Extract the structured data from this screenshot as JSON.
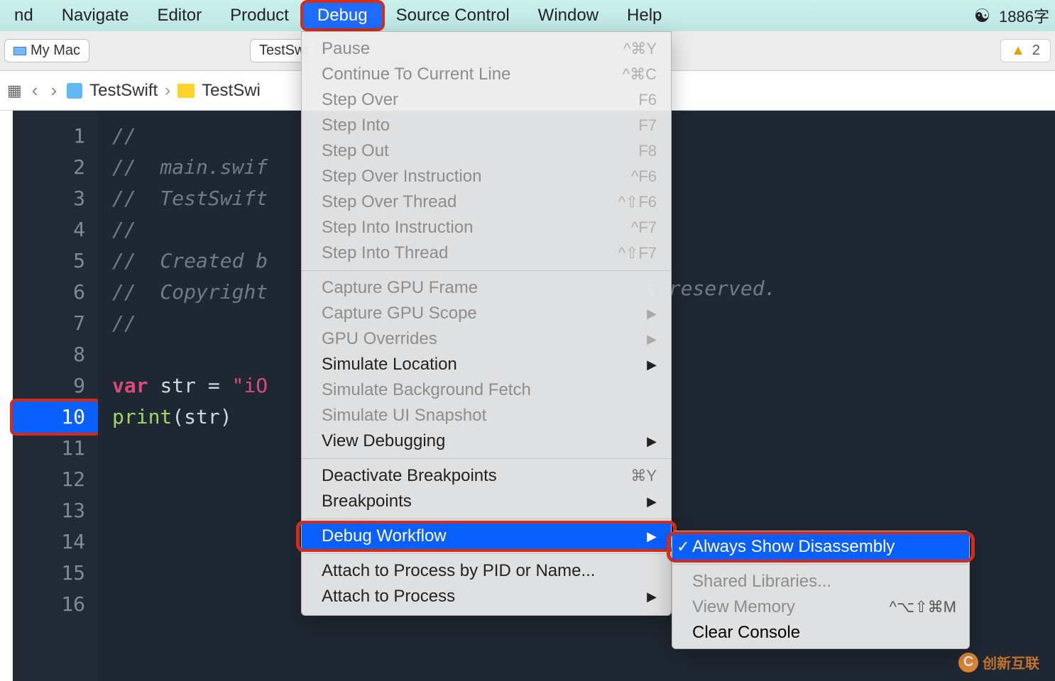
{
  "menubar": {
    "items": [
      "nd",
      "Navigate",
      "Editor",
      "Product",
      "Debug",
      "Source Control",
      "Window",
      "Help"
    ],
    "selected_index": 4,
    "right": {
      "wechat_icon": "wechat",
      "typecount": "1886字"
    }
  },
  "toolbar": {
    "scheme_label": "My Mac",
    "target_label": "TestSwi",
    "issue_count": "2"
  },
  "pathbar": {
    "segments": [
      "TestSwift",
      "TestSwi"
    ]
  },
  "code": {
    "breakpoint_line": 10,
    "lines": [
      {
        "n": 1,
        "text": "//"
      },
      {
        "n": 2,
        "text": "//  main.swif"
      },
      {
        "n": 3,
        "text": "//  TestSwift"
      },
      {
        "n": 4,
        "text": "//"
      },
      {
        "n": 5,
        "text": "//  Created b"
      },
      {
        "n": 6,
        "text": "//  Copyright"
      },
      {
        "n": 7,
        "text": "//"
      },
      {
        "n": 8,
        "text": ""
      },
      {
        "n": 9,
        "kind": "varline",
        "kw": "var",
        "id": "str",
        "op": " = ",
        "str": "\"iO"
      },
      {
        "n": 10,
        "kind": "printline",
        "fn": "print",
        "arg": "str"
      },
      {
        "n": 11,
        "text": ""
      },
      {
        "n": 12,
        "text": ""
      },
      {
        "n": 13,
        "text": ""
      },
      {
        "n": 14,
        "text": ""
      },
      {
        "n": 15,
        "text": ""
      },
      {
        "n": 16,
        "text": ""
      }
    ],
    "tail_comment": "s reserved."
  },
  "dropdown": {
    "groups": [
      [
        {
          "label": "Pause",
          "shortcut": "^⌘Y",
          "disabled": true
        },
        {
          "label": "Continue To Current Line",
          "shortcut": "^⌘C",
          "disabled": true
        },
        {
          "label": "Step Over",
          "shortcut": "F6",
          "disabled": true
        },
        {
          "label": "Step Into",
          "shortcut": "F7",
          "disabled": true
        },
        {
          "label": "Step Out",
          "shortcut": "F8",
          "disabled": true
        },
        {
          "label": "Step Over Instruction",
          "shortcut": "^F6",
          "disabled": true
        },
        {
          "label": "Step Over Thread",
          "shortcut": "^⇧F6",
          "disabled": true
        },
        {
          "label": "Step Into Instruction",
          "shortcut": "^F7",
          "disabled": true
        },
        {
          "label": "Step Into Thread",
          "shortcut": "^⇧F7",
          "disabled": true
        }
      ],
      [
        {
          "label": "Capture GPU Frame",
          "disabled": true
        },
        {
          "label": "Capture GPU Scope",
          "disabled": true,
          "submenu": true
        },
        {
          "label": "GPU Overrides",
          "disabled": true,
          "submenu": true
        },
        {
          "label": "Simulate Location",
          "submenu": true
        },
        {
          "label": "Simulate Background Fetch",
          "disabled": true
        },
        {
          "label": "Simulate UI Snapshot",
          "disabled": true
        },
        {
          "label": "View Debugging",
          "submenu": true
        }
      ],
      [
        {
          "label": "Deactivate Breakpoints",
          "shortcut": "⌘Y"
        },
        {
          "label": "Breakpoints",
          "submenu": true
        }
      ],
      [
        {
          "label": "Debug Workflow",
          "submenu": true,
          "highlight": true,
          "redbox": true
        }
      ],
      [
        {
          "label": "Attach to Process by PID or Name..."
        },
        {
          "label": "Attach to Process",
          "submenu": true
        }
      ]
    ]
  },
  "submenu": {
    "items": [
      {
        "label": "Always Show Disassembly",
        "checked": true,
        "highlight": true,
        "redbox": true
      },
      {
        "label": "Shared Libraries...",
        "disabled": true
      },
      {
        "label": "View Memory",
        "shortcut": "^⌥⇧⌘M",
        "disabled": true
      },
      {
        "label": "Clear Console"
      }
    ]
  },
  "watermark": "创新互联"
}
